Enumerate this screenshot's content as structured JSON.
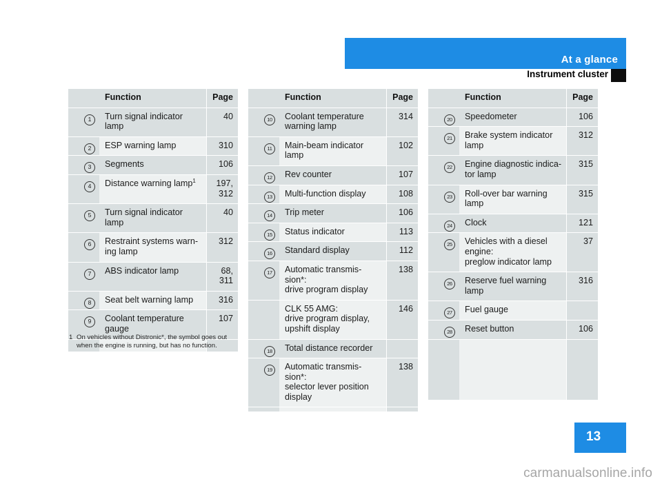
{
  "header": {
    "band_title": "At a glance",
    "sub_title": "Instrument cluster",
    "accent_color": "#1e8ce4",
    "marker_color": "#0d0d0d"
  },
  "table_headers": {
    "function": "Function",
    "page": "Page"
  },
  "columns": [
    {
      "id": "column-1",
      "rows": [
        {
          "marker": "1",
          "function": "Turn signal indicator\nlamp",
          "page": "40"
        },
        {
          "marker": "2",
          "function": "ESP warning lamp",
          "page": "310"
        },
        {
          "marker": "3",
          "function": "Segments",
          "page": "106"
        },
        {
          "marker": "4",
          "function": "Distance warning lamp",
          "footnote": "1",
          "page": "197,\n312"
        },
        {
          "marker": "5",
          "function": "Turn signal indicator\nlamp",
          "page": "40"
        },
        {
          "marker": "6",
          "function": "Restraint systems warn-\ning lamp",
          "page": "312"
        },
        {
          "marker": "7",
          "function": "ABS indicator lamp",
          "page": "68,\n311"
        },
        {
          "marker": "8",
          "function": "Seat belt warning lamp",
          "page": "316"
        },
        {
          "marker": "9",
          "function": "Coolant temperature\ngauge",
          "page": "107"
        }
      ],
      "filler_height": 18
    },
    {
      "id": "column-2",
      "rows": [
        {
          "marker": "10",
          "function": "Coolant temperature\nwarning lamp",
          "page": "314"
        },
        {
          "marker": "11",
          "function": "Main-beam indicator\nlamp",
          "page": "102"
        },
        {
          "marker": "12",
          "function": "Rev counter",
          "page": "107"
        },
        {
          "marker": "13",
          "function": "Multi-function display",
          "page": "108"
        },
        {
          "marker": "14",
          "function": "Trip meter",
          "page": "106"
        },
        {
          "marker": "15",
          "function": "Status indicator",
          "page": "113"
        },
        {
          "marker": "16",
          "function": "Standard display",
          "page": "112"
        },
        {
          "marker": "17",
          "function": "Automatic transmis-\nsion*:\ndrive program display",
          "page": "138",
          "continuation": {
            "function": "CLK 55 AMG:\ndrive program display,\nupshift display",
            "page": "146"
          }
        },
        {
          "marker": "18",
          "function": "Total distance recorder",
          "page": ""
        },
        {
          "marker": "19",
          "function": "Automatic transmis-\nsion*:\nselector lever position\ndisplay",
          "page": "138"
        }
      ],
      "filler_height": 6
    },
    {
      "id": "column-3",
      "rows": [
        {
          "marker": "20",
          "function": "Speedometer",
          "page": "106"
        },
        {
          "marker": "21",
          "function": "Brake system indicator\nlamp",
          "page": "312"
        },
        {
          "marker": "22",
          "function": "Engine diagnostic indica-\ntor lamp",
          "page": "315"
        },
        {
          "marker": "23",
          "function": "Roll-over bar warning\nlamp",
          "page": "315"
        },
        {
          "marker": "24",
          "function": "Clock",
          "page": "121"
        },
        {
          "marker": "25",
          "function": "Vehicles with a diesel\nengine:\npreglow indicator lamp",
          "page": "37"
        },
        {
          "marker": "26",
          "function": "Reserve fuel warning\nlamp",
          "page": "316"
        },
        {
          "marker": "27",
          "function": "Fuel gauge",
          "page": ""
        },
        {
          "marker": "28",
          "function": "Reset button",
          "page": "106"
        }
      ],
      "filler_height": 88
    }
  ],
  "footnote": {
    "number": "1",
    "text": "On vehicles without Distronic*, the symbol goes out when the engine is running, but has no function."
  },
  "page_number": "13",
  "watermark": "carmanualsonline.info"
}
